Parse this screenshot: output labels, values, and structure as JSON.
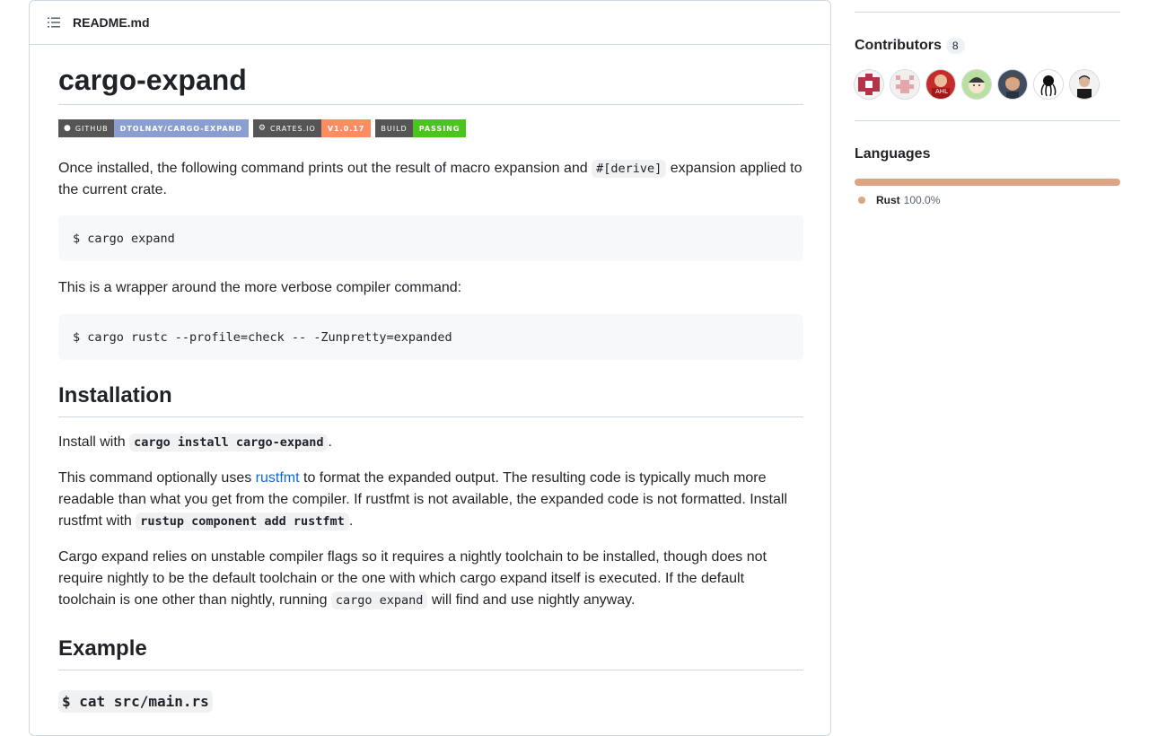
{
  "readme": {
    "filename": "README.md",
    "title": "cargo-expand",
    "badges": [
      {
        "left": "github",
        "right": "dtolnay/cargo-expand",
        "color": "#8a9ecf"
      },
      {
        "left": "crates.io",
        "right": "v1.0.17",
        "color": "#fc8d62"
      },
      {
        "left": "build",
        "right": "passing",
        "color": "#4ac51c"
      }
    ],
    "intro_before": "Once installed, the following command prints out the result of macro expansion and ",
    "intro_code": "#[derive]",
    "intro_after": " expansion applied to the current crate.",
    "code1": "$ cargo expand",
    "wrapper_text": "This is a wrapper around the more verbose compiler command:",
    "code2": "$ cargo rustc --profile=check -- -Zunpretty=expanded",
    "installation_heading": "Installation",
    "install_before": "Install with ",
    "install_code": "cargo install cargo-expand",
    "install_after": ".",
    "opt_before": "This command optionally uses ",
    "opt_link": "rustfmt",
    "opt_middle": " to format the expanded output. The resulting code is typically much more readable than what you get from the compiler. If rustfmt is not available, the expanded code is not formatted. Install rustfmt with ",
    "opt_code": "rustup component add rustfmt",
    "opt_after": ".",
    "nightly_before": "Cargo expand relies on unstable compiler flags so it requires a nightly toolchain to be installed, though does not require nightly to be the default toolchain or the one with which cargo expand itself is executed. If the default toolchain is one other than nightly, running ",
    "nightly_code": "cargo expand",
    "nightly_after": " will find and use nightly anyway.",
    "example_heading": "Example",
    "example_code": "$ cat src/main.rs"
  },
  "sidebar": {
    "contributors_title": "Contributors",
    "contributors_count": "8",
    "languages_title": "Languages",
    "languages": [
      {
        "name": "Rust",
        "percent": "100.0%",
        "fraction": 1.0,
        "color": "#dea584"
      }
    ]
  },
  "colors": {
    "link": "#0969da",
    "border": "#d1d9e0",
    "badge_left": "#555555"
  },
  "icons": [
    "list-icon",
    "github-icon",
    "crates-icon"
  ]
}
